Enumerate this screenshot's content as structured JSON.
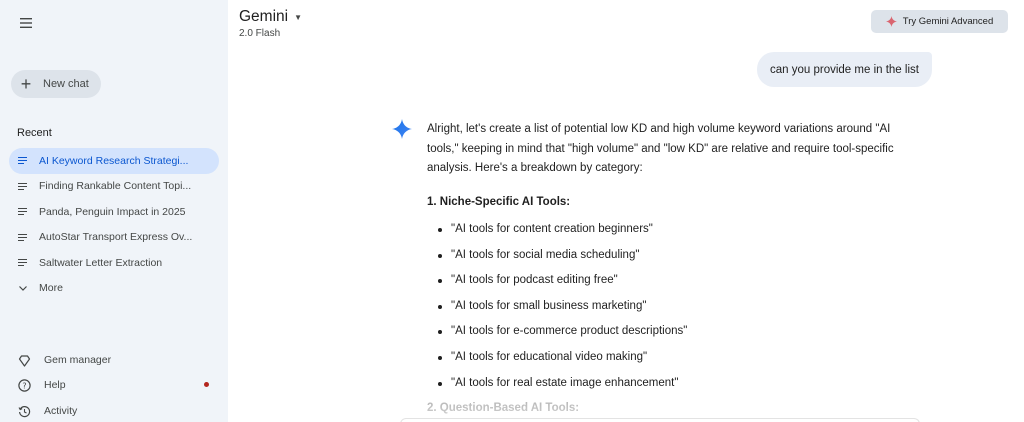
{
  "app": {
    "title": "Gemini",
    "model": "2.0 Flash",
    "upgrade_label": "Try Gemini Advanced"
  },
  "sidebar": {
    "new_chat_label": "New chat",
    "recent_heading": "Recent",
    "recent_items": [
      {
        "label": "AI Keyword Research Strategi...",
        "active": true
      },
      {
        "label": "Finding Rankable Content Topi...",
        "active": false
      },
      {
        "label": "Panda, Penguin Impact in 2025",
        "active": false
      },
      {
        "label": "AutoStar Transport Express Ov...",
        "active": false
      },
      {
        "label": "Saltwater Letter Extraction",
        "active": false
      }
    ],
    "more_label": "More",
    "bottom_items": [
      {
        "label": "Gem manager",
        "icon": "gem-icon"
      },
      {
        "label": "Help",
        "icon": "help-icon"
      },
      {
        "label": "Activity",
        "icon": "history-icon"
      }
    ]
  },
  "chat": {
    "user_message": "can you provide me in the list",
    "response_intro": "Alright, let's create a list of potential low KD and high volume keyword variations around \"AI tools,\" keeping in mind that \"high volume\" and \"low KD\" are relative and require tool-specific analysis. Here's a breakdown by category:",
    "section_1_title": "1. Niche-Specific AI Tools:",
    "section_1_items": [
      "\"AI tools for content creation beginners\"",
      "\"AI tools for social media scheduling\"",
      "\"AI tools for podcast editing free\"",
      "\"AI tools for small business marketing\"",
      "\"AI tools for e-commerce product descriptions\"",
      "\"AI tools for educational video making\"",
      "\"AI tools for real estate image enhancement\""
    ],
    "section_2_title": "2. Question-Based AI Tools:"
  },
  "colors": {
    "sidebar_bg": "#f0f4f9",
    "active_item_bg": "#d3e3fd",
    "active_item_text": "#0b57d0",
    "gemini_blue": "#4285f4",
    "advanced_star": "#d96570",
    "help_dot": "#b3261e"
  }
}
